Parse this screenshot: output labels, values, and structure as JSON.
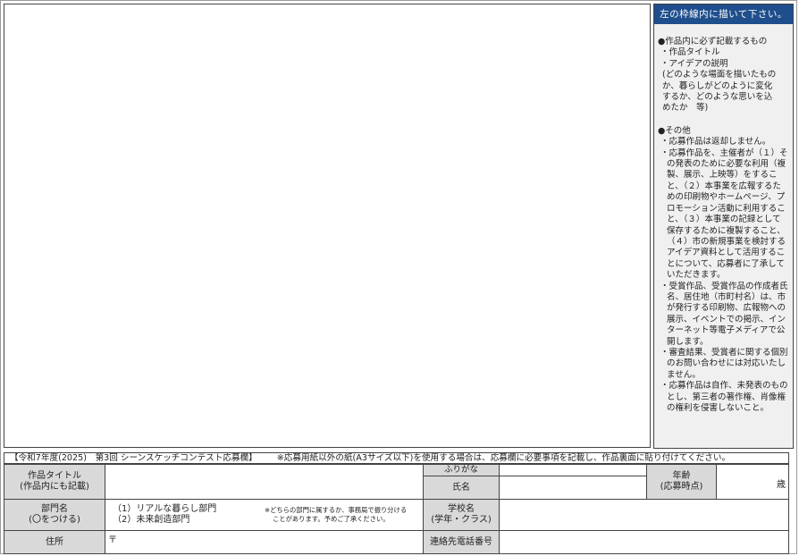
{
  "side_panel": {
    "header": "左の枠線内に描いて下さい。",
    "section1": {
      "heading": "●作品内に必ず記載するもの",
      "items": [
        "・作品タイトル",
        "・アイデアの説明"
      ],
      "sub_lines": [
        "(どのような場面を描いたもの",
        "か、暮らしがどのように変化",
        "するか、どのような思いを込",
        "めたか　等)"
      ]
    },
    "section2": {
      "heading": "●その他",
      "items": [
        "・応募作品は返却しません。",
        "・応募作品を、主催者が（１）その発表のために必要な利用（複製、展示、上映等）をすること、（２）本事業を広報するための印刷物やホームページ、プロモーション活動に利用すること、（３）本事業の記録として保存するために複製すること、（４）市の新規事業を検討するアイデア資料として活用することについて、応募者に了承していただきます。",
        "・受賞作品、受賞作品の作成者氏名、居住地（市町村名）は、市が発行する印刷物、広報物への展示、イベントでの掲示、インターネット等電子メディアで公開します。",
        "・審査結果、受賞者に関する個別のお問い合わせには対応いたしません。",
        "・応募作品は自作、未発表のものとし、第三者の著作権、肖像権の権利を侵害しないこと。"
      ]
    }
  },
  "notice": {
    "title": "【令和7年度(2025)　第3回 シーンスケッチコンテスト応募欄】",
    "text": "※応募用紙以外の紙(A3サイズ以下)を使用する場合は、応募欄に必要事項を記載し、作品裏面に貼り付けてください。"
  },
  "form": {
    "title_label_1": "作品タイトル",
    "title_label_2": "(作品内にも記載)",
    "furigana_label": "ふりがな",
    "name_label": "氏名",
    "age_label_1": "年齢",
    "age_label_2": "(応募時点)",
    "age_unit": "歳",
    "division_label_1": "部門名",
    "division_label_2": "(〇をつける)",
    "division_options": [
      "（1）リアルな暮らし部門",
      "（2）未来創造部門"
    ],
    "division_note_1": "※どちらの部門に属するか、事務局で振り分ける",
    "division_note_2": "ことがあります。予めご了承ください。",
    "school_label_1": "学校名",
    "school_label_2": "(学年・クラス)",
    "address_label": "住所",
    "postal_mark": "〒",
    "phone_label": "連絡先電話番号"
  }
}
